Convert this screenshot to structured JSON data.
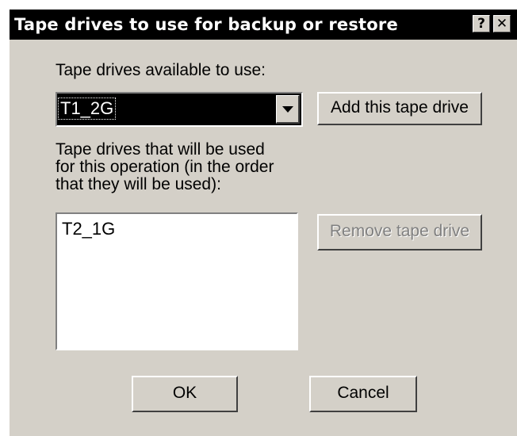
{
  "dialog": {
    "title": "Tape drives to use for backup or restore",
    "help_glyph": "?",
    "close_glyph": "✕",
    "available_label": "Tape drives available to use:",
    "available_selected": "T1_2G",
    "add_button": "Add this tape drive",
    "used_label_lines": [
      "Tape drives that will be used",
      "for this operation (in the order",
      "that they will be used):"
    ],
    "used_items": [
      "T2_1G"
    ],
    "remove_button": "Remove tape drive",
    "ok_button": "OK",
    "cancel_button": "Cancel"
  },
  "icons": {
    "help": "help-icon",
    "close": "close-icon",
    "dropdown": "chevron-down-icon"
  },
  "colors": {
    "titlebar": "#000000",
    "face": "#d4d0c8",
    "selection": "#000000"
  }
}
